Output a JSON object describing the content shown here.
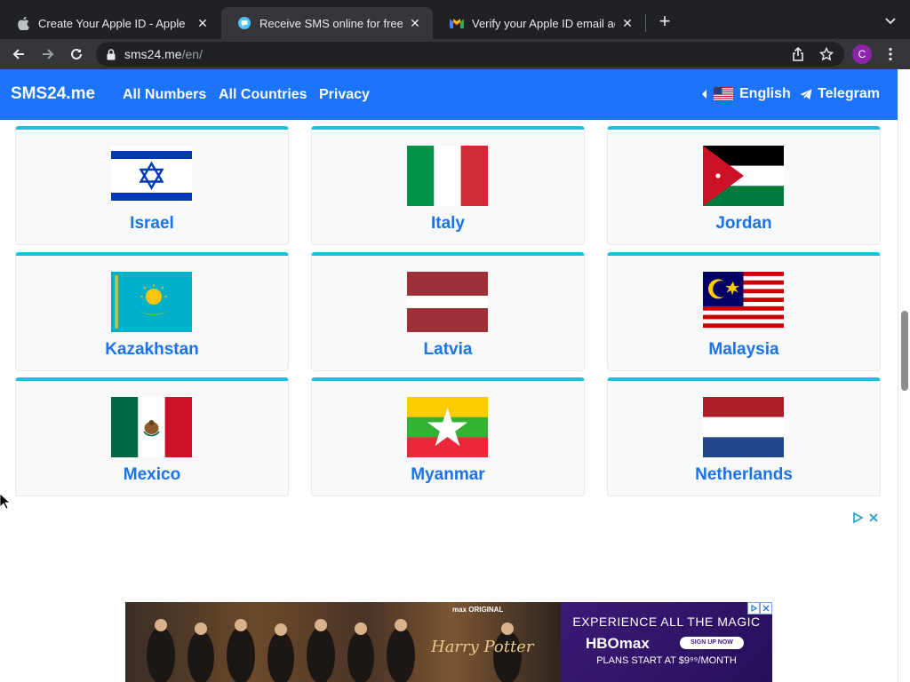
{
  "browser": {
    "tabs": [
      {
        "title": "Create Your Apple ID - Apple",
        "active": false
      },
      {
        "title": "Receive SMS online for free | T",
        "active": true
      },
      {
        "title": "Verify your Apple ID email addr",
        "active": false
      }
    ],
    "url_host": "sms24.me",
    "url_path": "/en/",
    "profile_initial": "C"
  },
  "site": {
    "brand": "SMS24.me",
    "nav": [
      "All Numbers",
      "All Countries",
      "Privacy"
    ],
    "language": "English",
    "telegram": "Telegram",
    "accent": "#1a73f8",
    "card_accent": "#1bc0dc"
  },
  "countries": [
    {
      "name": "Israel",
      "flag": "israel-flag"
    },
    {
      "name": "Italy",
      "flag": "italy-flag"
    },
    {
      "name": "Jordan",
      "flag": "jordan-flag"
    },
    {
      "name": "Kazakhstan",
      "flag": "kazakhstan-flag"
    },
    {
      "name": "Latvia",
      "flag": "latvia-flag"
    },
    {
      "name": "Malaysia",
      "flag": "malaysia-flag"
    },
    {
      "name": "Mexico",
      "flag": "mexico-flag"
    },
    {
      "name": "Myanmar",
      "flag": "myanmar-flag"
    },
    {
      "name": "Netherlands",
      "flag": "netherlands-flag"
    }
  ],
  "ad": {
    "headline": "EXPERIENCE ALL THE MAGIC",
    "brand": "HBOmax",
    "cta": "SIGN UP NOW",
    "plans": "PLANS START AT $9⁹⁹/MONTH",
    "title_art": "Harry Potter",
    "tag": "max ORIGINAL"
  }
}
